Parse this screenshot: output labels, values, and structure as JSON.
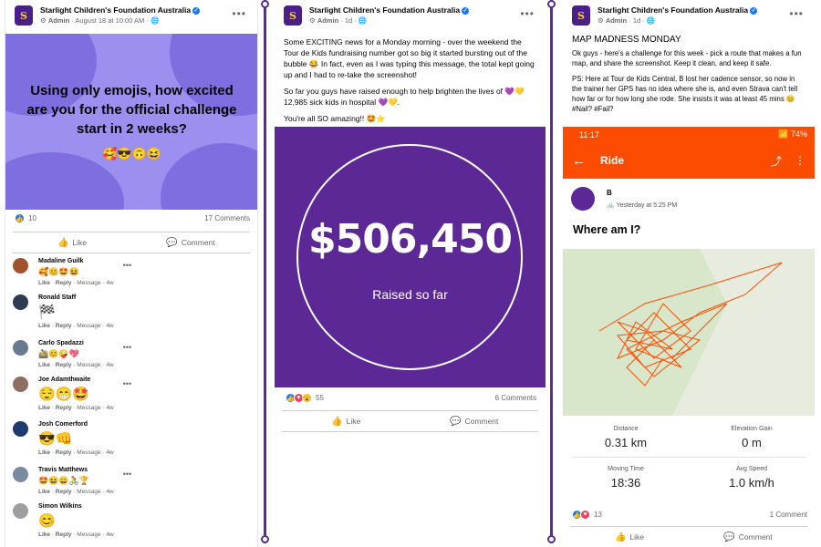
{
  "page_name": "Starlight Children's Foundation Australia",
  "logo_letter": "S",
  "post1": {
    "role": "Admin",
    "time": "August 18 at 10:00 AM",
    "image_text": "Using only emojis, how excited are you for the official challenge start in 2 weeks?",
    "image_emojis": "🥰😎🙃😆",
    "reaction_count": "10",
    "comment_count": "17 Comments",
    "like_label": "Like",
    "comment_label": "Comment",
    "comments": [
      {
        "name": "Madaline Guilk",
        "text": "🥰😊🤩😆",
        "age": "4w",
        "avatar_color": "#a0522d"
      },
      {
        "name": "Ronald Staff",
        "text": "🏁",
        "age": "4w",
        "avatar_color": "#2f3b52"
      },
      {
        "name": "Carlo Spadazzi",
        "text": "🚵😊🤪💖",
        "age": "4w",
        "avatar_color": "#6b7a8f"
      },
      {
        "name": "Joe Adamthwaite",
        "text": "😌😁🤩",
        "age": "4w",
        "avatar_color": "#8d6e63"
      },
      {
        "name": "Josh Comerford",
        "text": "😎👊",
        "age": "4w",
        "avatar_color": "#1e3a6e"
      },
      {
        "name": "Travis Matthews",
        "text": "🤩😆😀🚴🏆",
        "age": "4w",
        "avatar_color": "#7a8aa0"
      },
      {
        "name": "Simon Wilkins",
        "text": "😊",
        "age": "4w",
        "avatar_color": "#9e9e9e"
      }
    ],
    "comment_actions": {
      "like": "Like",
      "reply": "Reply",
      "message": "Message"
    }
  },
  "post2": {
    "role": "Admin",
    "time": "1d",
    "para1": "Some EXCITING news for a Monday morning - over the weekend the Tour de Kids fundraising number got so big it started bursting out of the bubble 😂 In fact, even as I was typing this message, the total kept going up and I had to re-take the screenshot!",
    "para2": "So far you guys have raised enough to help brighten the lives of 💜💛 12,985 sick kids in hospital 💜💛.",
    "para3": "You're all SO amazing!! 🤩⭐",
    "amount": "$506,450",
    "amount_caption": "Raised so far",
    "reaction_count": "55",
    "comment_count": "6 Comments",
    "like_label": "Like",
    "comment_label": "Comment"
  },
  "post3": {
    "role": "Admin",
    "time": "1d",
    "heading": "MAP MADNESS MONDAY",
    "para1": "Ok guys - here's a challenge for this week - pick a route that makes a fun map, and share the screenshot. Keep it clean, and keep it safe.",
    "para2": "PS: Here at Tour de Kids Central, B lost her cadence sensor, so now in the trainer her GPS has no idea where she is, and even Strava can't tell how far or for how long she rode. She insists it was at least 45 mins 😊 #Nail? #Fail?",
    "phone": {
      "clock": "11:17",
      "battery": "74%",
      "screen_title": "Ride",
      "athlete": "B",
      "date": "Yesterday at 5:25 PM",
      "activity_title": "Where am I?",
      "stats": [
        {
          "label": "Distance",
          "value": "0.31 km"
        },
        {
          "label": "Elevation Gain",
          "value": "0 m"
        },
        {
          "label": "Moving Time",
          "value": "18:36"
        },
        {
          "label": "Avg Speed",
          "value": "1.0 km/h"
        }
      ]
    },
    "reaction_count": "13",
    "comment_count": "1 Comment",
    "like_label": "Like",
    "comment_label": "Comment"
  },
  "colors": {
    "brand_purple": "#5b2896",
    "strava_orange": "#fc4c02",
    "fb_blue": "#1877f2"
  }
}
